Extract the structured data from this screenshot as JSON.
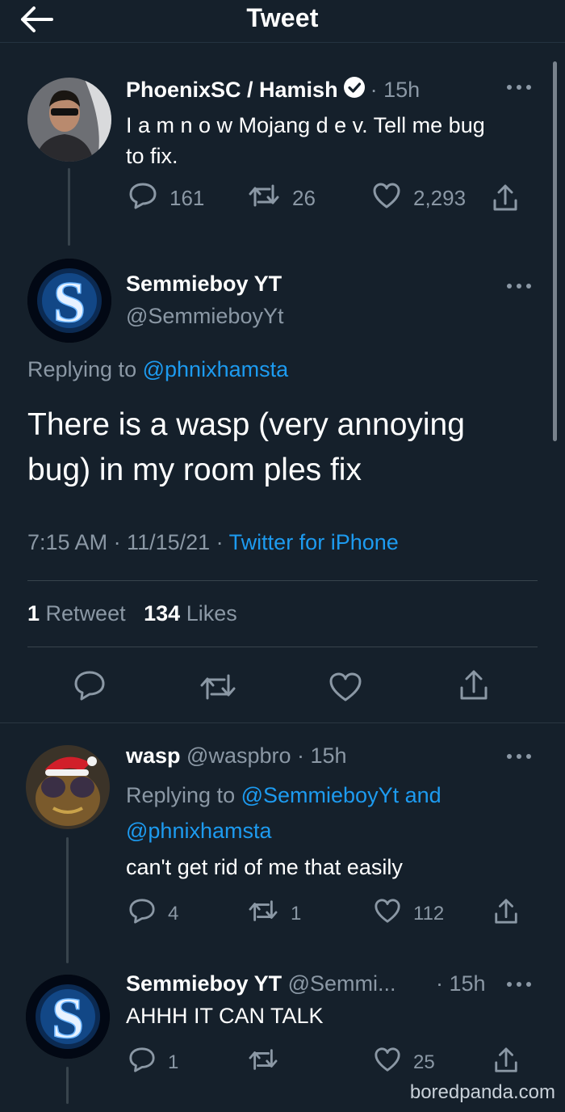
{
  "header": {
    "title": "Tweet",
    "back_icon": "arrow-left-icon"
  },
  "parent_tweet": {
    "name": "PhoenixSC / Hamish",
    "verified_icon": "verified-badge-icon",
    "time": "· 15h",
    "text_line1": "I a m n o w Mojang d e v. Tell me bug",
    "text_line2": "to fix.",
    "replies": "161",
    "retweets": "26",
    "likes": "2,293"
  },
  "main_tweet": {
    "name": "Semmieboy YT",
    "handle": "@SemmieboyYt",
    "replying_prefix": "Replying to",
    "replying_handle": "@phnixhamsta",
    "text_line1": "There is a wasp (very annoying",
    "text_line2": "bug) in my room ples fix",
    "time": "7:15 AM · 11/15/21 ·",
    "source": "Twitter for iPhone",
    "retweet_count": "1",
    "retweet_label": "Retweet",
    "likes_count": "134",
    "likes_label": "Likes"
  },
  "reply1": {
    "name": "wasp",
    "handle_time": "@waspbro · 15h",
    "replying_prefix": "Replying to",
    "replying_handles": "@SemmieboyYt and",
    "replying_handles2": "@phnixhamsta",
    "text": "can't get rid of me that easily",
    "replies": "4",
    "retweets": "1",
    "likes": "112"
  },
  "reply2": {
    "name": "Semmieboy YT",
    "handle": "@Semmi...",
    "time": "· 15h",
    "text": "AHHH IT CAN TALK",
    "replies": "1",
    "likes": "25"
  },
  "watermark": "boredpanda.com",
  "colors": {
    "background": "#15202b",
    "accent": "#1d9bf0",
    "muted": "#8b98a5",
    "divider": "#38444d"
  }
}
